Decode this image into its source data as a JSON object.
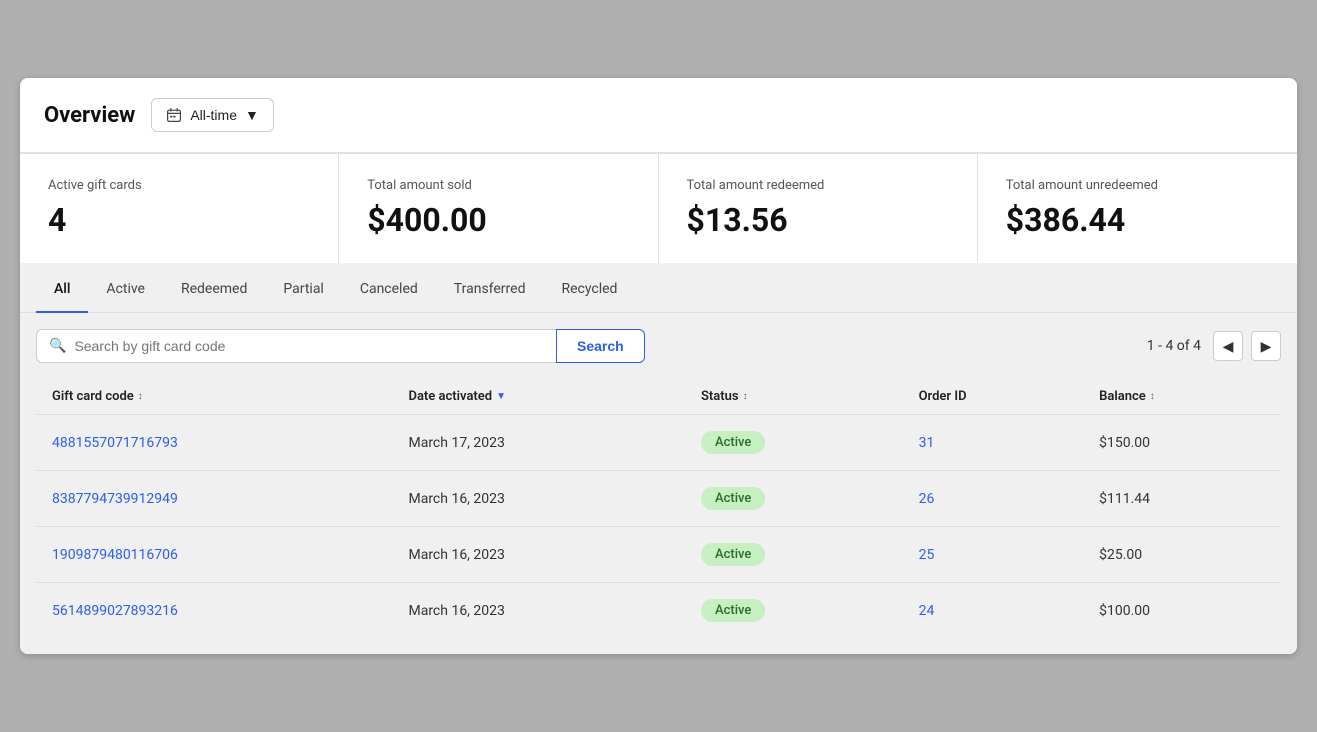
{
  "header": {
    "title": "Overview",
    "alltime_label": "All-time"
  },
  "stats": [
    {
      "label": "Active gift cards",
      "value": "4"
    },
    {
      "label": "Total amount sold",
      "value": "$400.00"
    },
    {
      "label": "Total amount redeemed",
      "value": "$13.56"
    },
    {
      "label": "Total amount unredeemed",
      "value": "$386.44"
    }
  ],
  "tabs": [
    {
      "label": "All",
      "active": true
    },
    {
      "label": "Active",
      "active": false
    },
    {
      "label": "Redeemed",
      "active": false
    },
    {
      "label": "Partial",
      "active": false
    },
    {
      "label": "Canceled",
      "active": false
    },
    {
      "label": "Transferred",
      "active": false
    },
    {
      "label": "Recycled",
      "active": false
    }
  ],
  "search": {
    "placeholder": "Search by gift card code",
    "button_label": "Search"
  },
  "pagination": {
    "text": "1 - 4 of 4"
  },
  "table": {
    "columns": [
      {
        "label": "Gift card code",
        "sort": "both"
      },
      {
        "label": "Date activated",
        "sort": "down"
      },
      {
        "label": "Status",
        "sort": "both"
      },
      {
        "label": "Order ID",
        "sort": "none"
      },
      {
        "label": "Balance",
        "sort": "both"
      }
    ],
    "rows": [
      {
        "code": "4881557071716793",
        "date": "March 17, 2023",
        "status": "Active",
        "order_id": "31",
        "balance": "$150.00"
      },
      {
        "code": "8387794739912949",
        "date": "March 16, 2023",
        "status": "Active",
        "order_id": "26",
        "balance": "$111.44"
      },
      {
        "code": "1909879480116706",
        "date": "March 16, 2023",
        "status": "Active",
        "order_id": "25",
        "balance": "$25.00"
      },
      {
        "code": "5614899027893216",
        "date": "March 16, 2023",
        "status": "Active",
        "order_id": "24",
        "balance": "$100.00"
      }
    ]
  }
}
